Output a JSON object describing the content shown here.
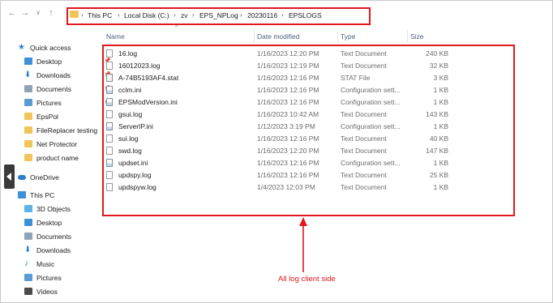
{
  "nav": {
    "back_icon": "←",
    "forward_icon": "→",
    "dropdown_icon": "∨",
    "up_icon": "↑"
  },
  "breadcrumb": [
    "This PC",
    "Local Disk (C:)",
    "zv",
    "EPS_NPLog",
    "20230116",
    "EPSLOGS"
  ],
  "sidebar": {
    "items": [
      {
        "label": "Quick access",
        "icon": "star-icon",
        "color": "#2b7cd3"
      },
      {
        "label": "Desktop",
        "icon": "desktop-icon",
        "color": "#3f8fd6",
        "pinned": true
      },
      {
        "label": "Downloads",
        "icon": "download-icon",
        "color": "#2b7cd3",
        "pinned": true
      },
      {
        "label": "Documents",
        "icon": "documents-icon",
        "color": "#8fa3b8",
        "pinned": true
      },
      {
        "label": "Pictures",
        "icon": "pictures-icon",
        "color": "#5b9bd5",
        "pinned": true
      },
      {
        "label": "EpsPol",
        "icon": "folder-icon",
        "color": "#f2c55c"
      },
      {
        "label": "FileReplacer testing",
        "icon": "folder-icon",
        "color": "#f2c55c"
      },
      {
        "label": "Net Protector",
        "icon": "folder-icon",
        "color": "#f2c55c"
      },
      {
        "label": "product name",
        "icon": "folder-icon",
        "color": "#f2c55c"
      },
      {
        "label": "OneDrive",
        "icon": "onedrive-icon",
        "color": "#2b7cd3"
      },
      {
        "label": "This PC",
        "icon": "this-pc-icon",
        "color": "#3f8fd6"
      },
      {
        "label": "3D Objects",
        "icon": "3d-objects-icon",
        "color": "#5bb3e6"
      },
      {
        "label": "Desktop",
        "icon": "desktop-icon",
        "color": "#3f8fd6"
      },
      {
        "label": "Documents",
        "icon": "documents-icon",
        "color": "#8fa3b8"
      },
      {
        "label": "Downloads",
        "icon": "download-icon",
        "color": "#2b7cd3"
      },
      {
        "label": "Music",
        "icon": "music-icon",
        "color": "#2b7cd3"
      },
      {
        "label": "Pictures",
        "icon": "pictures-icon",
        "color": "#5b9bd5"
      },
      {
        "label": "Videos",
        "icon": "videos-icon",
        "color": "#4a4a4a"
      }
    ],
    "pin_glyph": "📌"
  },
  "columns": {
    "name": "Name",
    "date": "Date modified",
    "type": "Type",
    "size": "Size"
  },
  "files": [
    {
      "name": "16.log",
      "date": "1/16/2023 12:20 PM",
      "type": "Text Document",
      "size": "240 KB",
      "icon": "text-file-icon"
    },
    {
      "name": "16012023.log",
      "date": "1/16/2023 12:19 PM",
      "type": "Text Document",
      "size": "32 KB",
      "icon": "text-file-icon"
    },
    {
      "name": "A-74B5193AF4.stat",
      "date": "1/16/2023 12:16 PM",
      "type": "STAT File",
      "size": "3 KB",
      "icon": "stat-file-icon"
    },
    {
      "name": "cclm.ini",
      "date": "1/16/2023 12:16 PM",
      "type": "Configuration sett...",
      "size": "1 KB",
      "icon": "config-file-icon"
    },
    {
      "name": "EPSModVersion.ini",
      "date": "1/16/2023 12:16 PM",
      "type": "Configuration sett...",
      "size": "1 KB",
      "icon": "config-file-icon"
    },
    {
      "name": "gsui.log",
      "date": "1/16/2023 10:42 AM",
      "type": "Text Document",
      "size": "143 KB",
      "icon": "text-file-icon"
    },
    {
      "name": "ServerIP.ini",
      "date": "1/12/2023 3:19 PM",
      "type": "Configuration sett...",
      "size": "1 KB",
      "icon": "config-file-icon"
    },
    {
      "name": "sui.log",
      "date": "1/16/2023 12:16 PM",
      "type": "Text Document",
      "size": "40 KB",
      "icon": "text-file-icon"
    },
    {
      "name": "swd.log",
      "date": "1/16/2023 12:20 PM",
      "type": "Text Document",
      "size": "147 KB",
      "icon": "text-file-icon"
    },
    {
      "name": "updset.ini",
      "date": "1/16/2023 12:16 PM",
      "type": "Configuration sett...",
      "size": "1 KB",
      "icon": "config-file-icon"
    },
    {
      "name": "updspy.log",
      "date": "1/16/2023 12:16 PM",
      "type": "Text Document",
      "size": "25 KB",
      "icon": "text-file-icon"
    },
    {
      "name": "updspyw.log",
      "date": "1/4/2023 12:03 PM",
      "type": "Text Document",
      "size": "1 KB",
      "icon": "text-file-icon"
    }
  ],
  "annotation": {
    "text": "All log client side",
    "color": "#e0171f"
  }
}
